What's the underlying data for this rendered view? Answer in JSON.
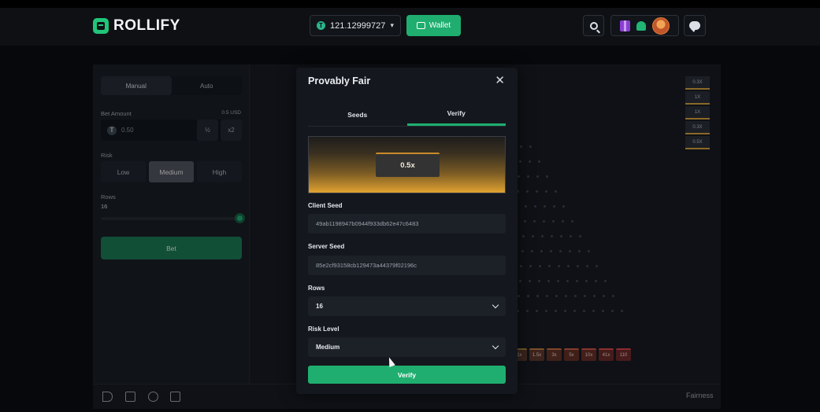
{
  "header": {
    "brand": "ROLLIFY",
    "balance": "121.12999727",
    "wallet_label": "Wallet"
  },
  "sidebar": {
    "mode_tabs": [
      "Manual",
      "Auto"
    ],
    "bet_amount_label": "Bet Amount",
    "bet_amount_usd": "0.5 USD",
    "bet_amount_value": "0.50",
    "half_label": "½",
    "double_label": "x2",
    "risk_label": "Risk",
    "risk_options": [
      "Low",
      "Medium",
      "High"
    ],
    "rows_label": "Rows",
    "rows_value": "16",
    "bet_button": "Bet"
  },
  "board": {
    "buckets": [
      "1x",
      "1.5x",
      "3x",
      "5x",
      "10x",
      "41x",
      "110"
    ],
    "history": [
      "0.3X",
      "1X",
      "1X",
      "0.3X",
      "0.5X"
    ]
  },
  "footer": {
    "fairness": "Fairness"
  },
  "modal": {
    "title": "Provably Fair",
    "tabs": [
      "Seeds",
      "Verify"
    ],
    "preview_value": "0.5x",
    "client_seed_label": "Client Seed",
    "client_seed": "49ab1198947b0944f933db62e47c6483",
    "server_seed_label": "Server Seed",
    "server_seed": "85e2cf93158cb129473a44379f02196c",
    "rows_label": "Rows",
    "rows_value": "16",
    "risk_label": "Risk Level",
    "risk_value": "Medium",
    "verify_button": "Verify"
  },
  "colors": {
    "accent": "#1fae6f",
    "background": "#0b0d11",
    "panel": "#14171d"
  }
}
